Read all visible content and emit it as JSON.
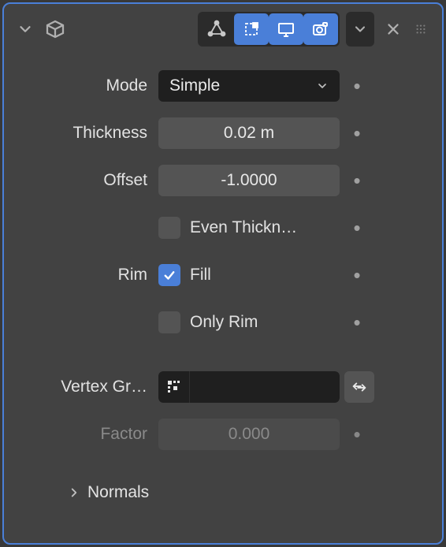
{
  "header": {
    "toggles": {
      "vertex": {
        "active": false,
        "name": "vertex-mode-icon"
      },
      "edit": {
        "active": true,
        "name": "edit-mode-icon"
      },
      "display": {
        "active": true,
        "name": "display-mode-icon"
      },
      "render": {
        "active": true,
        "name": "render-mode-icon"
      }
    }
  },
  "props": {
    "mode": {
      "label": "Mode",
      "value": "Simple"
    },
    "thickness": {
      "label": "Thickness",
      "value": "0.02 m"
    },
    "offset": {
      "label": "Offset",
      "value": "-1.0000"
    },
    "even": {
      "label": "Even Thickn…",
      "checked": false
    },
    "rim": {
      "label": "Rim",
      "fill": {
        "label": "Fill",
        "checked": true
      },
      "only": {
        "label": "Only Rim",
        "checked": false
      }
    },
    "vgroup": {
      "label": "Vertex Gr…",
      "value": ""
    },
    "factor": {
      "label": "Factor",
      "value": "0.000",
      "enabled": false
    },
    "normals": {
      "label": "Normals",
      "expanded": false
    }
  }
}
